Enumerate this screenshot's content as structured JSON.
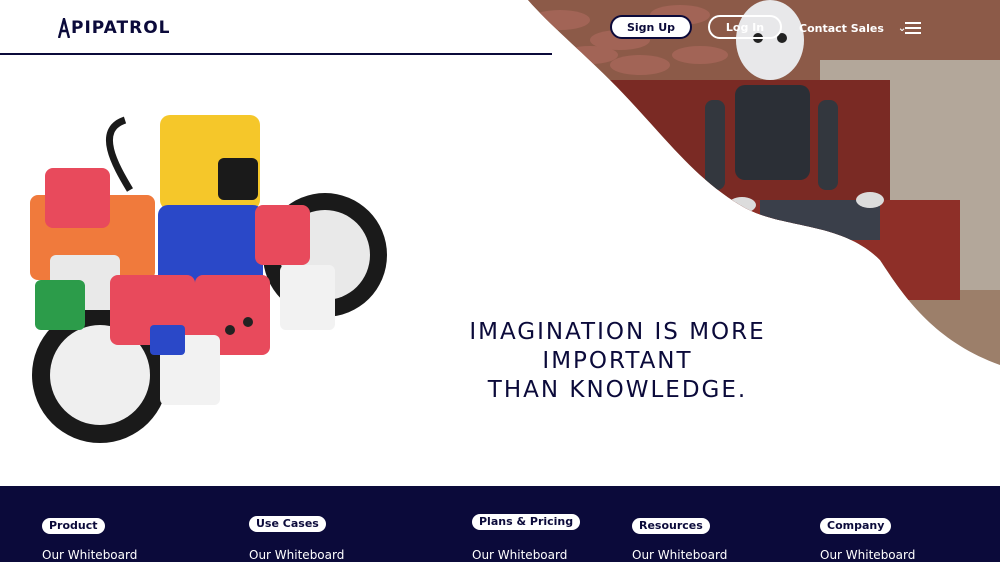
{
  "header": {
    "logo_text": "PIPATROL",
    "signup_label": "Sign Up",
    "login_label": "Log In",
    "contact_label": "Contact Sales",
    "chevron_icon": "chevron-down-icon",
    "menu_icon": "hamburger-menu-icon"
  },
  "hero": {
    "headline_line1": "IMAGINATION IS MORE IMPORTANT",
    "headline_line2": "THAN KNOWLEDGE."
  },
  "footer": {
    "columns": [
      {
        "title": "Product",
        "link": "Our Whiteboard"
      },
      {
        "title": "Use Cases",
        "link": "Our Whiteboard"
      },
      {
        "title": "Plans & Pricing",
        "link": "Our Whiteboard"
      },
      {
        "title": "Resources",
        "link": "Our Whiteboard"
      },
      {
        "title": "Company",
        "link": "Our Whiteboard"
      }
    ]
  },
  "colors": {
    "brand_navy": "#0b0a3a",
    "white": "#ffffff"
  }
}
